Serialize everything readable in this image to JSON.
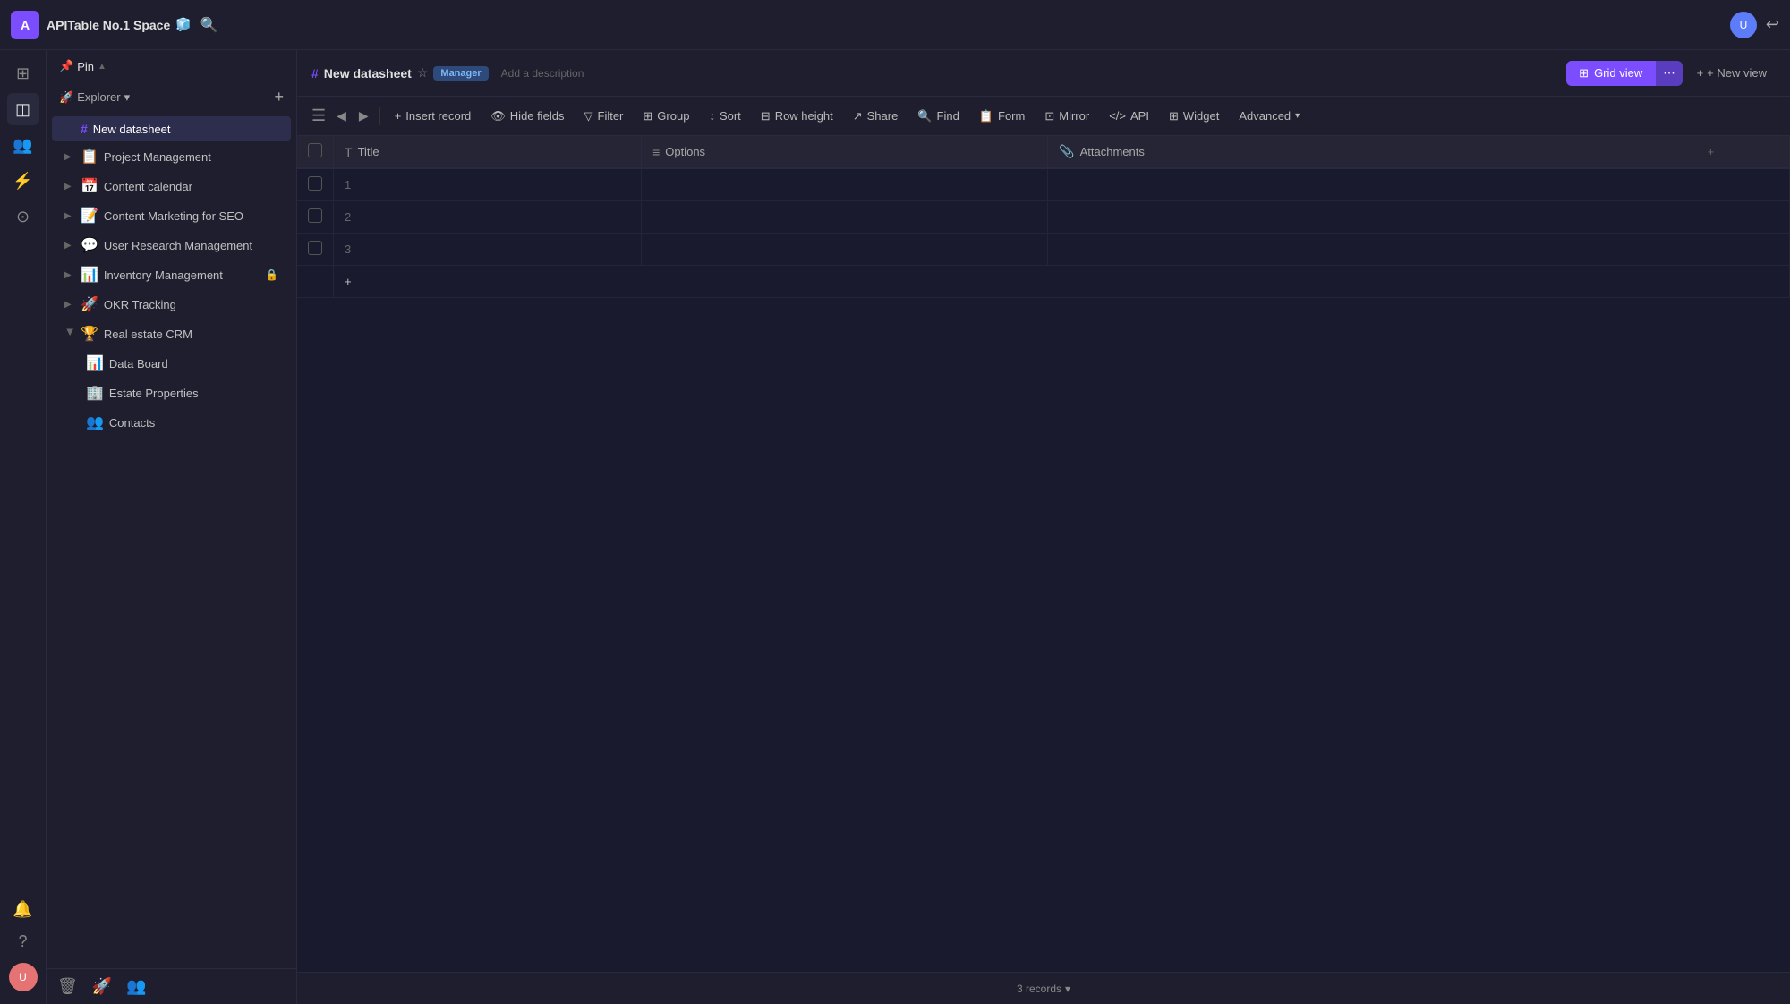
{
  "workspace": {
    "initial": "A",
    "name": "APITable No.1 Space",
    "emoji_icon": "🧊"
  },
  "sidebar_icons": [
    {
      "name": "home-icon",
      "glyph": "⊞",
      "active": false
    },
    {
      "name": "table-icon",
      "glyph": "⊟",
      "active": true
    },
    {
      "name": "team-icon",
      "glyph": "👥",
      "active": false
    },
    {
      "name": "automation-icon",
      "glyph": "⚡",
      "active": false
    },
    {
      "name": "settings-icon",
      "glyph": "⚙",
      "active": false
    }
  ],
  "pin": {
    "label": "Pin",
    "chevron": "▲"
  },
  "explorer": {
    "title": "Explorer",
    "chevron": "▾",
    "add_label": "+"
  },
  "nav_items": [
    {
      "id": "new-datasheet",
      "icon": "#",
      "label": "New datasheet",
      "active": true,
      "indent": 0,
      "type": "datasheet"
    },
    {
      "id": "project-management",
      "icon": "📋",
      "label": "Project Management",
      "active": false,
      "indent": 0,
      "type": "folder"
    },
    {
      "id": "content-calendar",
      "icon": "📅",
      "label": "Content calendar",
      "active": false,
      "indent": 0,
      "type": "folder"
    },
    {
      "id": "content-marketing",
      "icon": "📝",
      "label": "Content Marketing for SEO",
      "active": false,
      "indent": 0,
      "type": "folder"
    },
    {
      "id": "user-research",
      "icon": "💬",
      "label": "User Research Management",
      "active": false,
      "indent": 0,
      "type": "folder"
    },
    {
      "id": "inventory-management",
      "icon": "📊",
      "label": "Inventory Management",
      "active": false,
      "indent": 0,
      "type": "folder",
      "locked": true
    },
    {
      "id": "okr-tracking",
      "icon": "🚀",
      "label": "OKR Tracking",
      "active": false,
      "indent": 0,
      "type": "folder"
    },
    {
      "id": "real-estate-crm",
      "icon": "🏆",
      "label": "Real estate CRM",
      "active": false,
      "indent": 0,
      "type": "folder",
      "expanded": true
    },
    {
      "id": "data-board",
      "icon": "📊",
      "label": "Data Board",
      "active": false,
      "indent": 1,
      "type": "datasheet"
    },
    {
      "id": "estate-properties",
      "icon": "🏢",
      "label": "Estate Properties",
      "active": false,
      "indent": 1,
      "type": "datasheet"
    },
    {
      "id": "contacts",
      "icon": "👥",
      "label": "Contacts",
      "active": false,
      "indent": 1,
      "type": "datasheet"
    }
  ],
  "bottom_nav": [
    {
      "name": "trash-icon",
      "glyph": "🗑"
    },
    {
      "name": "rocket-icon",
      "glyph": "🚀"
    },
    {
      "name": "people-icon",
      "glyph": "👥"
    }
  ],
  "sheet": {
    "name": "New datasheet",
    "badge": "Manager",
    "description": "Add a description",
    "star_icon": "☆"
  },
  "toolbar": {
    "insert_record": "Insert record",
    "hide_fields": "Hide fields",
    "filter": "Filter",
    "group": "Group",
    "sort": "Sort",
    "row_height": "Row height",
    "share": "Share",
    "find": "Find",
    "form": "Form",
    "mirror": "Mirror",
    "api": "API",
    "widget": "Widget",
    "advanced": "Advanced"
  },
  "views": {
    "grid_view": "Grid view",
    "new_view": "+ New view"
  },
  "table": {
    "columns": [
      {
        "id": "checkbox",
        "label": "",
        "type": "checkbox"
      },
      {
        "id": "title",
        "label": "Title",
        "type": "text",
        "icon": "T"
      },
      {
        "id": "options",
        "label": "Options",
        "type": "options",
        "icon": "≡"
      },
      {
        "id": "attachments",
        "label": "Attachments",
        "type": "attachment",
        "icon": "📎"
      },
      {
        "id": "add",
        "label": "+",
        "type": "add"
      }
    ],
    "rows": [
      {
        "num": "1",
        "title": "",
        "options": "",
        "attachments": ""
      },
      {
        "num": "2",
        "title": "",
        "options": "",
        "attachments": ""
      },
      {
        "num": "3",
        "title": "",
        "options": "",
        "attachments": ""
      }
    ]
  },
  "footer": {
    "records_count": "3 records",
    "chevron": "▾"
  }
}
